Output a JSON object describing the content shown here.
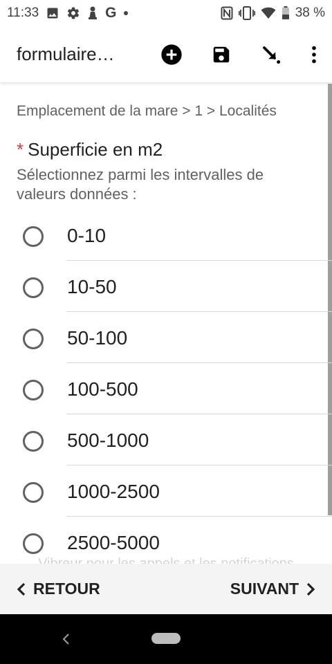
{
  "status_bar": {
    "time": "11:33",
    "battery_percent": "38 %",
    "left_icons": [
      "image-icon",
      "gear-icon",
      "chess-pawn-icon",
      "google-g-icon",
      "dot-icon"
    ],
    "right_icons": [
      "nfc-icon",
      "vibrate-icon",
      "wifi-icon",
      "battery-icon"
    ]
  },
  "app_bar": {
    "title": "formulaire…",
    "actions": [
      "add-circle-icon",
      "save-icon",
      "download-arrow-icon",
      "more-vert-icon"
    ]
  },
  "breadcrumb": "Emplacement de la mare > 1 > Localités",
  "question": {
    "required_mark": "*",
    "label": "Superficie en m2",
    "hint": "Sélectionnez parmi les intervalles de valeurs données :"
  },
  "options": [
    {
      "label": "0-10",
      "selected": false
    },
    {
      "label": "10-50",
      "selected": false
    },
    {
      "label": "50-100",
      "selected": false
    },
    {
      "label": "100-500",
      "selected": false
    },
    {
      "label": "500-1000",
      "selected": false
    },
    {
      "label": "1000-2500",
      "selected": false
    },
    {
      "label": "2500-5000",
      "selected": false
    }
  ],
  "toast": "Vibreur pour les appels et les notifications",
  "bottom_bar": {
    "back_label": "RETOUR",
    "next_label": "SUIVANT"
  },
  "colors": {
    "required": "#e53935",
    "text_primary": "#212121",
    "text_secondary": "#616161",
    "bottom_bar_bg": "#f4f4f4"
  }
}
